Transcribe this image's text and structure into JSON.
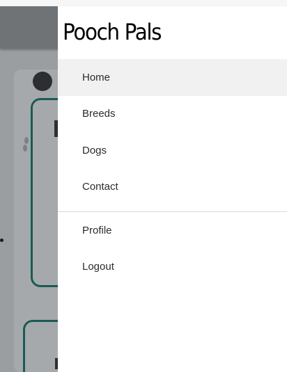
{
  "drawer": {
    "title": "Pooch Pals",
    "primary_items": [
      {
        "label": "Home",
        "active": true
      },
      {
        "label": "Breeds",
        "active": false
      },
      {
        "label": "Dogs",
        "active": false
      },
      {
        "label": "Contact",
        "active": false
      }
    ],
    "account_items": [
      {
        "label": "Profile"
      },
      {
        "label": "Logout"
      }
    ]
  },
  "colors": {
    "overlay": "#9a9ea1",
    "header": "#6f7376",
    "card_border": "#1b5a54",
    "active_item_bg": "#f1f1f1"
  }
}
